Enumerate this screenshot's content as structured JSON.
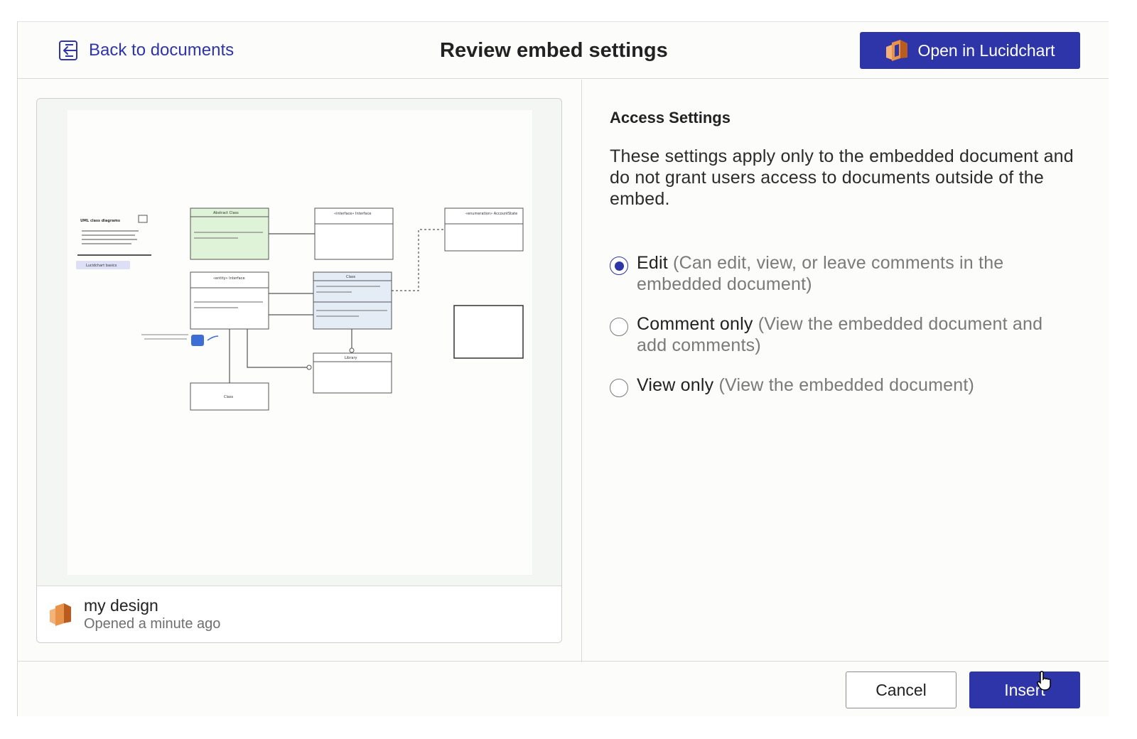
{
  "header": {
    "back_label": "Back to documents",
    "title": "Review embed settings",
    "open_label": "Open in Lucidchart"
  },
  "preview": {
    "doc_name": "my design",
    "doc_time": "Opened a minute ago",
    "diagram": {
      "title": "UML class diagrams",
      "badge": "Lucidchart basics",
      "boxes": [
        "Abstract Class",
        "«interface» Interface",
        "«enumeration» AccountState",
        "«entity» Interface",
        "Class",
        "Library",
        "Class"
      ]
    }
  },
  "settings": {
    "heading": "Access Settings",
    "description": "These settings apply only to the embedded document and do not grant users access to documents outside of the embed.",
    "options": [
      {
        "label": "Edit",
        "desc": "(Can edit, view, or leave comments in the embedded document)",
        "selected": true
      },
      {
        "label": "Comment only",
        "desc": "(View the embedded document and add comments)",
        "selected": false
      },
      {
        "label": "View only",
        "desc": "(View the embedded document)",
        "selected": false
      }
    ]
  },
  "footer": {
    "cancel_label": "Cancel",
    "insert_label": "Insert"
  },
  "colors": {
    "accent": "#2e35a8",
    "logo_orange": "#d9782e"
  }
}
